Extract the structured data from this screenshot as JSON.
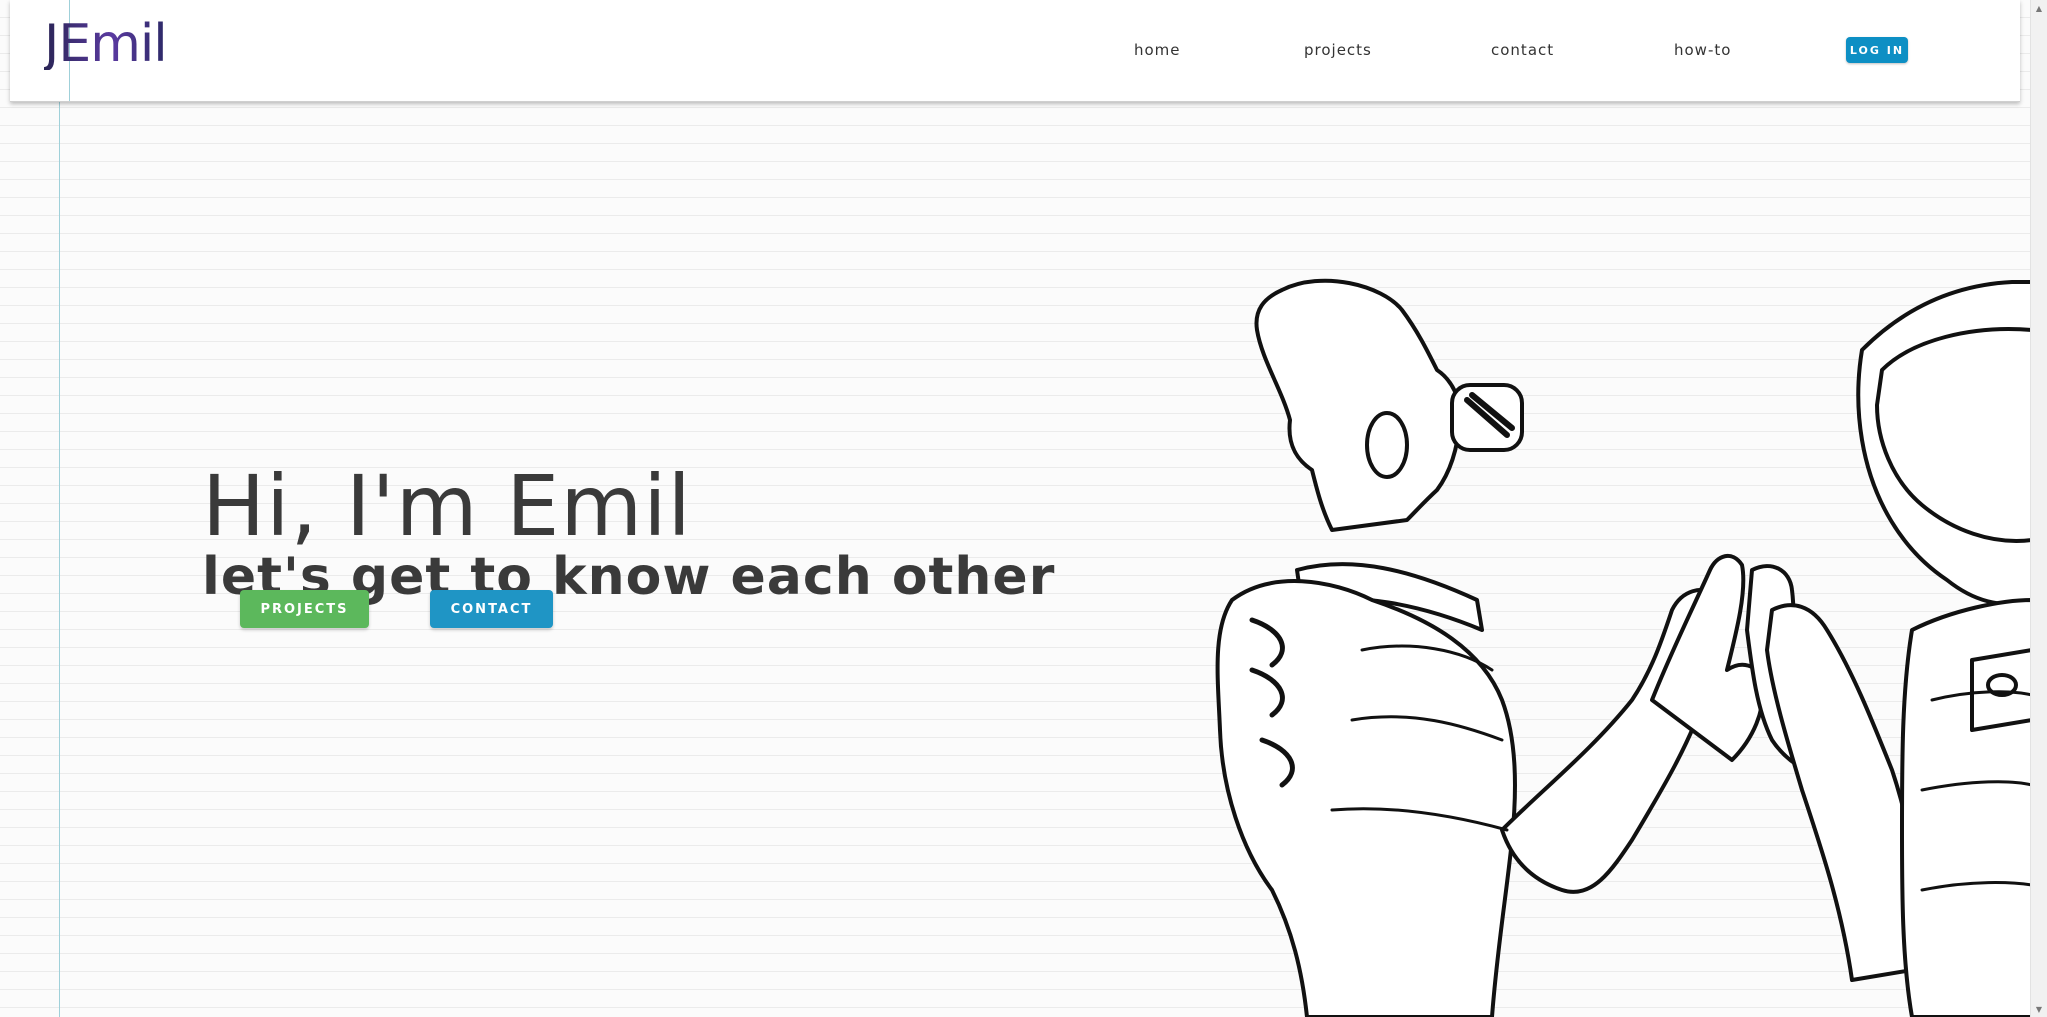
{
  "brand": {
    "name": "JEmil"
  },
  "nav": {
    "links": [
      {
        "label": "home"
      },
      {
        "label": "projects"
      },
      {
        "label": "contact"
      },
      {
        "label": "how-to"
      }
    ],
    "login_label": "LOG IN"
  },
  "hero": {
    "title": "Hi, I'm Emil",
    "subtitle": "let's get to know each other",
    "projects_button": "PROJECTS",
    "contact_button": "CONTACT"
  },
  "illustration": {
    "description_icon": "alien-astronaut-high-five-illustration"
  },
  "scrollbar": {
    "up_arrow": "▲",
    "down_arrow": "▼"
  },
  "colors": {
    "login": "#0d8fc4",
    "projects": "#5cb85c",
    "contact": "#1f95c5",
    "text": "#3a3a3a"
  }
}
